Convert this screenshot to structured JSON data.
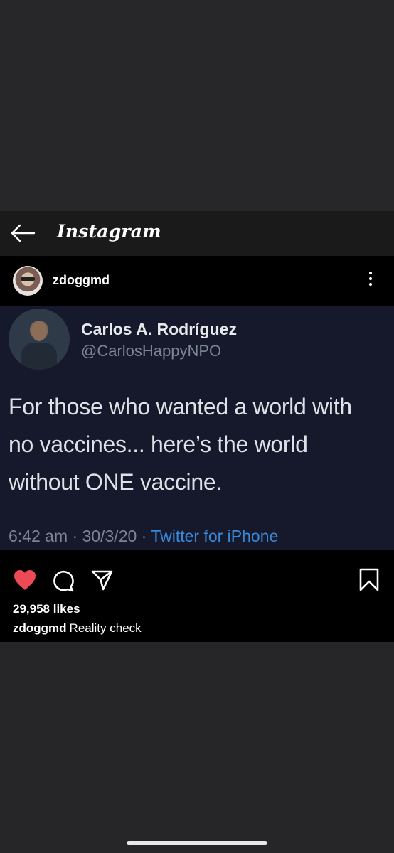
{
  "header": {
    "app_name": "Instagram"
  },
  "post": {
    "username": "zdoggmd",
    "likes": "29,958 likes",
    "caption_user": "zdoggmd",
    "caption_text": "Reality check"
  },
  "tweet": {
    "display_name": "Carlos A. Rodríguez",
    "handle": "@CarlosHappyNPO",
    "text": "For those who wanted a world with\nno vaccines... here’s the world\nwithout ONE vaccine.",
    "timestamp": "6:42 am · 30/3/20 · ",
    "source": "Twitter for iPhone"
  },
  "colors": {
    "like_red": "#ed4956",
    "twitter_blue": "#3a88d8",
    "tweet_bg": "#15192b"
  },
  "icons": [
    "back-arrow-icon",
    "more-options-icon",
    "heart-icon",
    "comment-icon",
    "share-icon",
    "bookmark-icon"
  ]
}
